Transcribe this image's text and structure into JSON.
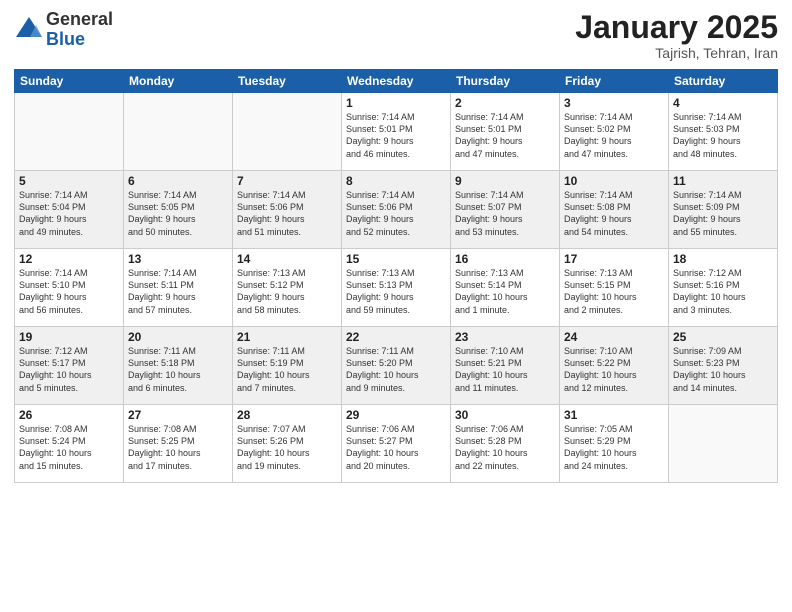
{
  "logo": {
    "general": "General",
    "blue": "Blue"
  },
  "header": {
    "title": "January 2025",
    "location": "Tajrish, Tehran, Iran"
  },
  "days_of_week": [
    "Sunday",
    "Monday",
    "Tuesday",
    "Wednesday",
    "Thursday",
    "Friday",
    "Saturday"
  ],
  "weeks": [
    [
      {
        "day": "",
        "info": ""
      },
      {
        "day": "",
        "info": ""
      },
      {
        "day": "",
        "info": ""
      },
      {
        "day": "1",
        "info": "Sunrise: 7:14 AM\nSunset: 5:01 PM\nDaylight: 9 hours\nand 46 minutes."
      },
      {
        "day": "2",
        "info": "Sunrise: 7:14 AM\nSunset: 5:01 PM\nDaylight: 9 hours\nand 47 minutes."
      },
      {
        "day": "3",
        "info": "Sunrise: 7:14 AM\nSunset: 5:02 PM\nDaylight: 9 hours\nand 47 minutes."
      },
      {
        "day": "4",
        "info": "Sunrise: 7:14 AM\nSunset: 5:03 PM\nDaylight: 9 hours\nand 48 minutes."
      }
    ],
    [
      {
        "day": "5",
        "info": "Sunrise: 7:14 AM\nSunset: 5:04 PM\nDaylight: 9 hours\nand 49 minutes."
      },
      {
        "day": "6",
        "info": "Sunrise: 7:14 AM\nSunset: 5:05 PM\nDaylight: 9 hours\nand 50 minutes."
      },
      {
        "day": "7",
        "info": "Sunrise: 7:14 AM\nSunset: 5:06 PM\nDaylight: 9 hours\nand 51 minutes."
      },
      {
        "day": "8",
        "info": "Sunrise: 7:14 AM\nSunset: 5:06 PM\nDaylight: 9 hours\nand 52 minutes."
      },
      {
        "day": "9",
        "info": "Sunrise: 7:14 AM\nSunset: 5:07 PM\nDaylight: 9 hours\nand 53 minutes."
      },
      {
        "day": "10",
        "info": "Sunrise: 7:14 AM\nSunset: 5:08 PM\nDaylight: 9 hours\nand 54 minutes."
      },
      {
        "day": "11",
        "info": "Sunrise: 7:14 AM\nSunset: 5:09 PM\nDaylight: 9 hours\nand 55 minutes."
      }
    ],
    [
      {
        "day": "12",
        "info": "Sunrise: 7:14 AM\nSunset: 5:10 PM\nDaylight: 9 hours\nand 56 minutes."
      },
      {
        "day": "13",
        "info": "Sunrise: 7:14 AM\nSunset: 5:11 PM\nDaylight: 9 hours\nand 57 minutes."
      },
      {
        "day": "14",
        "info": "Sunrise: 7:13 AM\nSunset: 5:12 PM\nDaylight: 9 hours\nand 58 minutes."
      },
      {
        "day": "15",
        "info": "Sunrise: 7:13 AM\nSunset: 5:13 PM\nDaylight: 9 hours\nand 59 minutes."
      },
      {
        "day": "16",
        "info": "Sunrise: 7:13 AM\nSunset: 5:14 PM\nDaylight: 10 hours\nand 1 minute."
      },
      {
        "day": "17",
        "info": "Sunrise: 7:13 AM\nSunset: 5:15 PM\nDaylight: 10 hours\nand 2 minutes."
      },
      {
        "day": "18",
        "info": "Sunrise: 7:12 AM\nSunset: 5:16 PM\nDaylight: 10 hours\nand 3 minutes."
      }
    ],
    [
      {
        "day": "19",
        "info": "Sunrise: 7:12 AM\nSunset: 5:17 PM\nDaylight: 10 hours\nand 5 minutes."
      },
      {
        "day": "20",
        "info": "Sunrise: 7:11 AM\nSunset: 5:18 PM\nDaylight: 10 hours\nand 6 minutes."
      },
      {
        "day": "21",
        "info": "Sunrise: 7:11 AM\nSunset: 5:19 PM\nDaylight: 10 hours\nand 7 minutes."
      },
      {
        "day": "22",
        "info": "Sunrise: 7:11 AM\nSunset: 5:20 PM\nDaylight: 10 hours\nand 9 minutes."
      },
      {
        "day": "23",
        "info": "Sunrise: 7:10 AM\nSunset: 5:21 PM\nDaylight: 10 hours\nand 11 minutes."
      },
      {
        "day": "24",
        "info": "Sunrise: 7:10 AM\nSunset: 5:22 PM\nDaylight: 10 hours\nand 12 minutes."
      },
      {
        "day": "25",
        "info": "Sunrise: 7:09 AM\nSunset: 5:23 PM\nDaylight: 10 hours\nand 14 minutes."
      }
    ],
    [
      {
        "day": "26",
        "info": "Sunrise: 7:08 AM\nSunset: 5:24 PM\nDaylight: 10 hours\nand 15 minutes."
      },
      {
        "day": "27",
        "info": "Sunrise: 7:08 AM\nSunset: 5:25 PM\nDaylight: 10 hours\nand 17 minutes."
      },
      {
        "day": "28",
        "info": "Sunrise: 7:07 AM\nSunset: 5:26 PM\nDaylight: 10 hours\nand 19 minutes."
      },
      {
        "day": "29",
        "info": "Sunrise: 7:06 AM\nSunset: 5:27 PM\nDaylight: 10 hours\nand 20 minutes."
      },
      {
        "day": "30",
        "info": "Sunrise: 7:06 AM\nSunset: 5:28 PM\nDaylight: 10 hours\nand 22 minutes."
      },
      {
        "day": "31",
        "info": "Sunrise: 7:05 AM\nSunset: 5:29 PM\nDaylight: 10 hours\nand 24 minutes."
      },
      {
        "day": "",
        "info": ""
      }
    ]
  ]
}
